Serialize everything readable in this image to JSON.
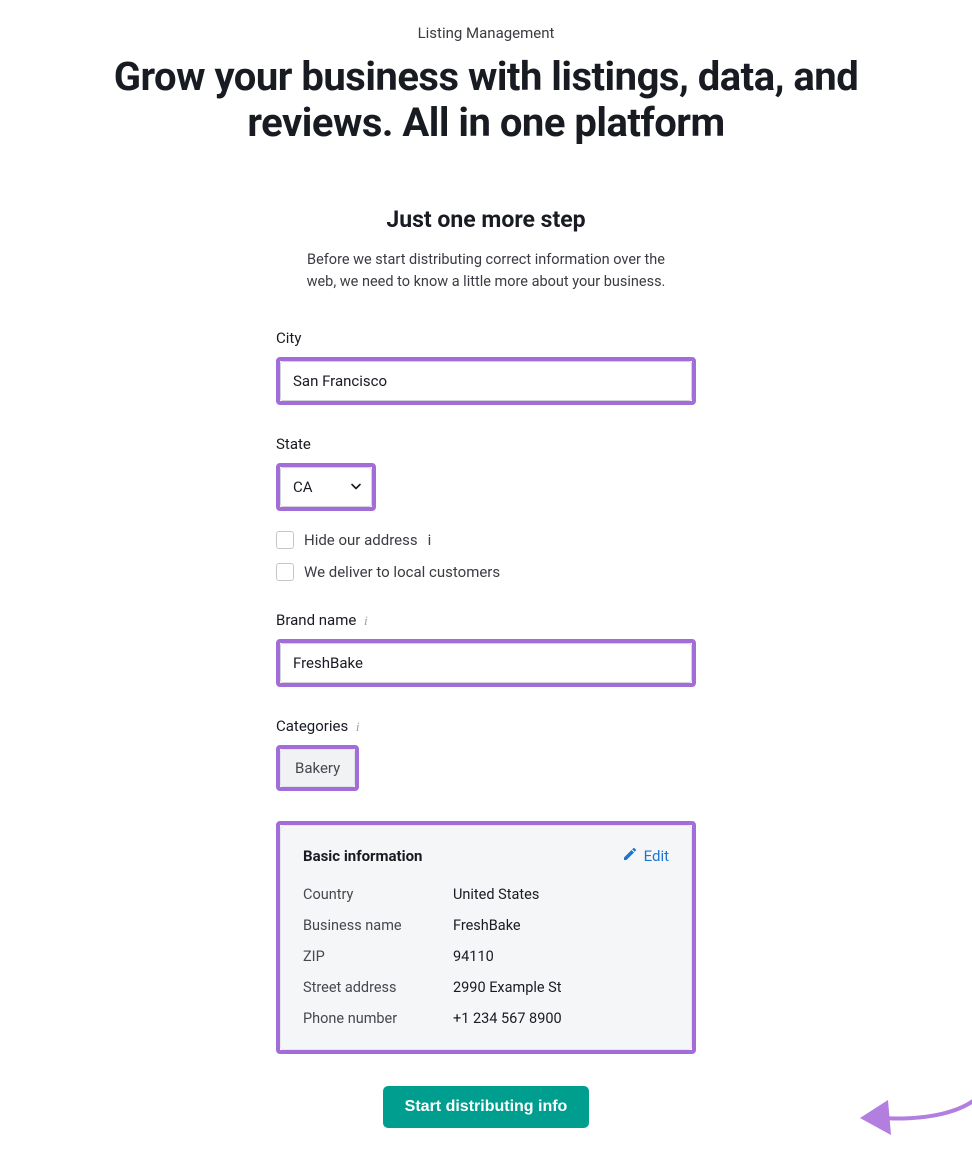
{
  "breadcrumb": "Listing Management",
  "hero_title": "Grow your business with listings, data, and reviews. All in one platform",
  "step": {
    "title": "Just one more step",
    "description": "Before we start distributing correct information over the web, we need to know a little more about your business."
  },
  "form": {
    "city": {
      "label": "City",
      "value": "San Francisco"
    },
    "state": {
      "label": "State",
      "value": "CA"
    },
    "hide_address": {
      "label": "Hide our address",
      "checked": false
    },
    "deliver_local": {
      "label": "We deliver to local customers",
      "checked": false
    },
    "brand_name": {
      "label": "Brand name",
      "value": "FreshBake"
    },
    "categories": {
      "label": "Categories",
      "chip": "Bakery"
    }
  },
  "basic_info": {
    "card_title": "Basic information",
    "edit_label": "Edit",
    "rows": [
      {
        "key": "Country",
        "value": "United States"
      },
      {
        "key": "Business name",
        "value": "FreshBake"
      },
      {
        "key": "ZIP",
        "value": "94110"
      },
      {
        "key": "Street address",
        "value": "2990 Example St"
      },
      {
        "key": "Phone number",
        "value": "+1 234 567 8900"
      }
    ]
  },
  "cta": {
    "label": "Start distributing info"
  },
  "colors": {
    "highlight_border": "#a26dd8",
    "cta": "#009e8e",
    "link": "#1f74d1"
  }
}
